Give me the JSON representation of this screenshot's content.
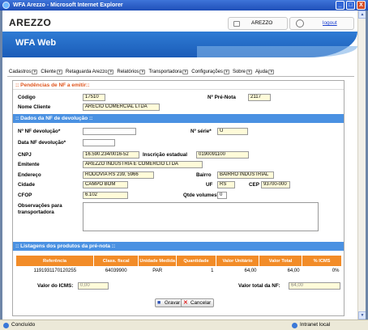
{
  "window": {
    "title": "WFA Arezzo - Microsoft Internet Explorer",
    "buttons": [
      "_",
      "□",
      "X"
    ]
  },
  "header": {
    "brand": "AREZZO",
    "user": "AREZZO",
    "logout": "logout",
    "app_title": "WFA Web"
  },
  "menu": [
    "Cadastros",
    "Cliente",
    "Retaguarda Arezzo",
    "Relatórios",
    "Transportadora",
    "Configurações",
    "Sobre",
    "Ajuda"
  ],
  "sections": {
    "pending": ":: Pendências de NF a emitir::",
    "devolucao": ":: Dados da NF de devolução ::",
    "listagem": ":: Listagens dos produtos da pré-nota ::"
  },
  "fields": {
    "codigo": {
      "label": "Código",
      "value": "17510"
    },
    "pre_nota": {
      "label": "Nº Pré-Nota",
      "value": "2117"
    },
    "nome_cliente": {
      "label": "Nome Cliente",
      "value": "ARÉCIO COMERCIAL LTDA"
    },
    "nf_devolucao": {
      "label": "Nº NF devolução*",
      "value": ""
    },
    "serie": {
      "label": "Nº série*",
      "value": "U"
    },
    "data_nf": {
      "label": "Data NF devolução*",
      "value": ""
    },
    "cnpj": {
      "label": "CNPJ",
      "value": "16.590.234/0016-52"
    },
    "inscricao": {
      "label": "Inscrição estadual",
      "value": "0190091100"
    },
    "emitente": {
      "label": "Emitente",
      "value": "AREZZO INDUSTRIA E COMÉRCIO LTDA"
    },
    "endereco": {
      "label": "Endereço",
      "value": "RODOVIA RS 239, 5966"
    },
    "bairro": {
      "label": "Bairro",
      "value": "BAIRRO INDUSTRIAL"
    },
    "cidade": {
      "label": "Cidade",
      "value": "CAMPO BOM"
    },
    "uf": {
      "label": "UF",
      "value": "RS"
    },
    "cep": {
      "label": "CEP",
      "value": "93700-000"
    },
    "cfop": {
      "label": "CFOP",
      "value": "6.102"
    },
    "qtde_volumes": {
      "label": "Qtde volumes*",
      "value": "0"
    },
    "observacoes": {
      "label1": "Observações para",
      "label2": "transportadora",
      "value": ""
    }
  },
  "table": {
    "columns": [
      "Referência",
      "Class. fiscal",
      "Unidade Medida",
      "Quantidade",
      "Valor Unitário",
      "Valor Total",
      "% ICMS"
    ],
    "rows": [
      [
        "1191931170120255",
        "64039900",
        "PAR",
        "1",
        "64,00",
        "64,00",
        "0%"
      ]
    ]
  },
  "totals": {
    "icms_label": "Valor do ICMS:",
    "icms_value": "0,00",
    "total_label": "Valor total da NF:",
    "total_value": "64,00"
  },
  "buttons": {
    "gravar": "Gravar",
    "cancelar": "Cancelar"
  },
  "status": {
    "left": "Concluído",
    "right": "Intranet local"
  }
}
